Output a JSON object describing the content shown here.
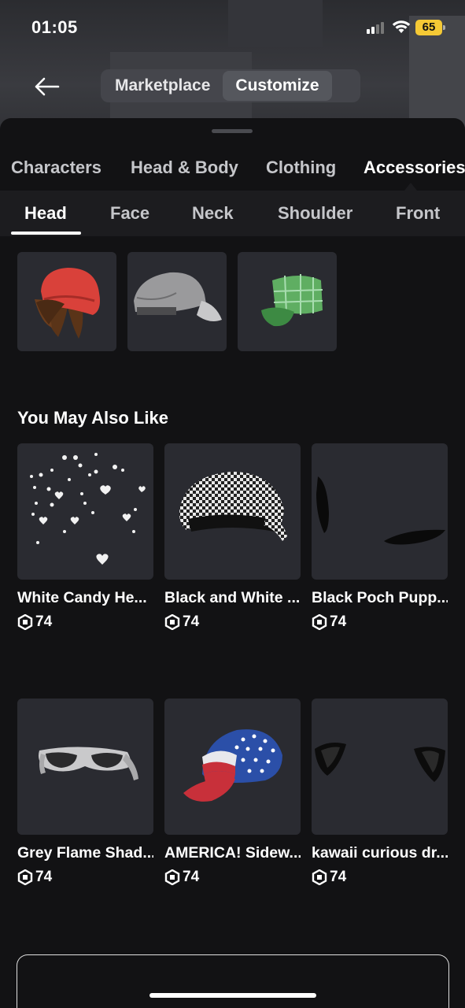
{
  "status_bar": {
    "time": "01:05",
    "battery": "65"
  },
  "header": {
    "back_icon": "arrow-left-icon",
    "segments": [
      {
        "label": "Marketplace",
        "active": false
      },
      {
        "label": "Customize",
        "active": true
      }
    ]
  },
  "categories": [
    "Characters",
    "Head & Body",
    "Clothing",
    "Accessories"
  ],
  "active_category": "Accessories",
  "subcategories": [
    "Head",
    "Face",
    "Neck",
    "Shoulder",
    "Front"
  ],
  "active_subcategory": "Head",
  "worn_items": [
    "hair-with-red-beanie",
    "grey-cap",
    "green-plaid-cap"
  ],
  "recommendations": {
    "title": "You May Also Like",
    "items": [
      {
        "name": "White Candy He...",
        "price": "74"
      },
      {
        "name": "Black and White ...",
        "price": "74"
      },
      {
        "name": "Black Poch Pupp...",
        "price": "74"
      },
      {
        "name": "Grey Flame Shad...",
        "price": "74"
      },
      {
        "name": "AMERICA! Sidew...",
        "price": "74"
      },
      {
        "name": "kawaii curious dr...",
        "price": "74"
      }
    ]
  },
  "colors": {
    "background": "#121214",
    "card": "#2a2b31",
    "battery": "#f5c935"
  }
}
